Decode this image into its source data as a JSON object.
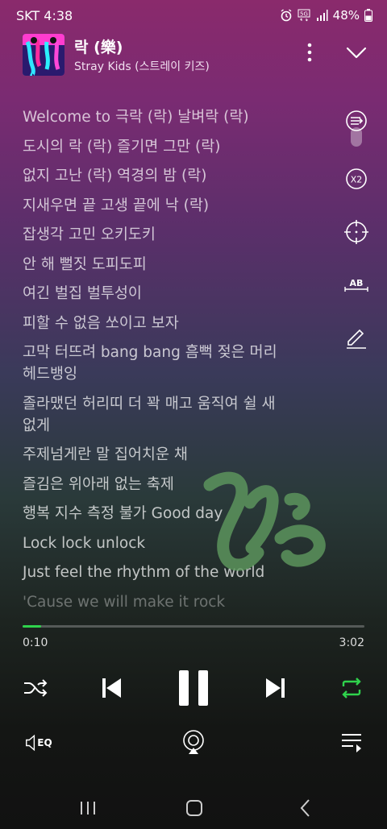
{
  "status": {
    "carrier_time": "SKT 4:38",
    "battery": "48%",
    "icons": [
      "alarm-icon",
      "5g-icon",
      "signal-icon",
      "battery-icon"
    ]
  },
  "now_playing": {
    "title": "락 (樂)",
    "artist": "Stray Kids (스트레이 키즈)"
  },
  "lyrics": [
    "Welcome to 극락 (락) 날벼락 (락)",
    "도시의 락 (락) 즐기면 그만 (락)",
    "없지 고난 (락) 역경의 밤 (락)",
    "지새우면 끝 고생 끝에 낙 (락)",
    "잡생각 고민 오키도키",
    "안 해 뻘짓 도피도피",
    "여긴 벌집 벌투성이",
    "피할 수 없음 쏘이고 보자",
    "고막 터뜨려 bang bang 흠뻑 젖은 머리",
    "헤드뱅잉",
    "졸라맸던 허리띠 더 꽉 매고 움직여 쉴 새",
    "없게",
    "주제넘게란 말 집어치운 채",
    "즐김은 위아래 없는 축제",
    "행복 지수 측정 불가 Good day",
    "Lock lock unlock",
    "Just feel the rhythm of the world",
    "'Cause we will make it rock"
  ],
  "side_tools": {
    "speed_label": "X2",
    "translate_label": "AB"
  },
  "playback": {
    "current_time": "0:10",
    "total_time": "3:02",
    "progress": 0.055,
    "accent_color": "#2fd34c"
  },
  "bottom": {
    "eq_label": "EQ"
  }
}
